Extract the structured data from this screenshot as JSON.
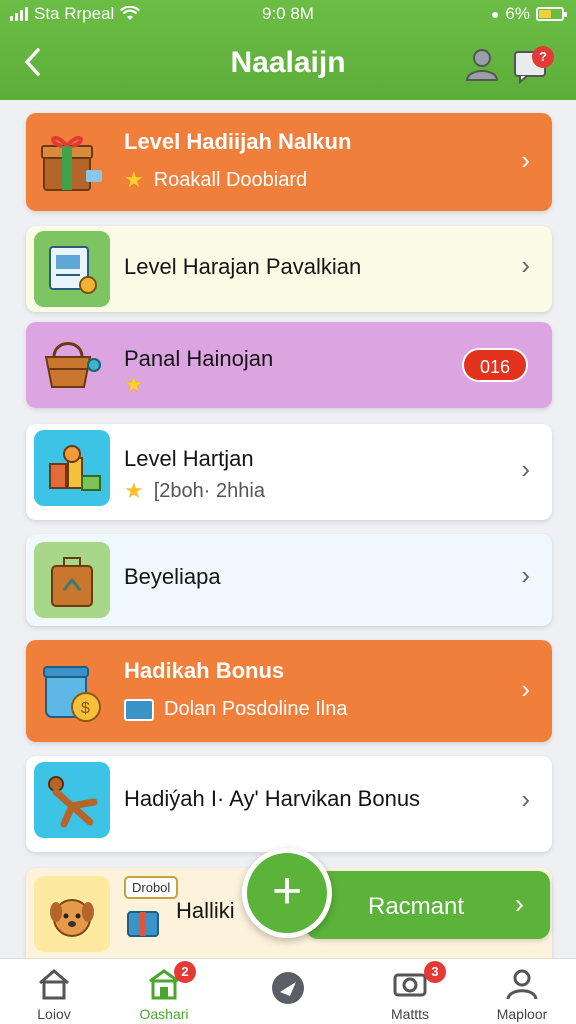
{
  "status": {
    "carrier": "Sta Rrpeal",
    "time": "9:0 8M",
    "battery": "6%"
  },
  "header": {
    "title": "Naalaijn",
    "notification_count": "?"
  },
  "cards": [
    {
      "title": "Level Hadiijah Nalkun",
      "subtitle": "Roakall Doobiard"
    },
    {
      "title": "Level Harajan Pavalkian"
    },
    {
      "title": "Panal Hainojan",
      "badge": "016"
    },
    {
      "title": "Level Hartjan",
      "subtitle": "[2boh· 2hhia"
    },
    {
      "title": "Beyeliapa"
    },
    {
      "title": "Hadikah Bonus",
      "subtitle": "Dolan Posdoline Ilna"
    },
    {
      "title": "Hadiýah I· Ay' Harvikan Bonus"
    },
    {
      "title": "Halliki",
      "tag": "Drobol"
    }
  ],
  "cta": {
    "label": "Racmant"
  },
  "tabs": [
    {
      "label": "Loiov",
      "badge": ""
    },
    {
      "label": "Oashari",
      "badge": "2"
    },
    {
      "label": "",
      "badge": ""
    },
    {
      "label": "Mattts",
      "badge": "3"
    },
    {
      "label": "Maploor",
      "badge": ""
    }
  ],
  "colors": {
    "primary_green": "#5cae3a",
    "orange": "#f07f3c",
    "badge_red": "#e3331f"
  }
}
